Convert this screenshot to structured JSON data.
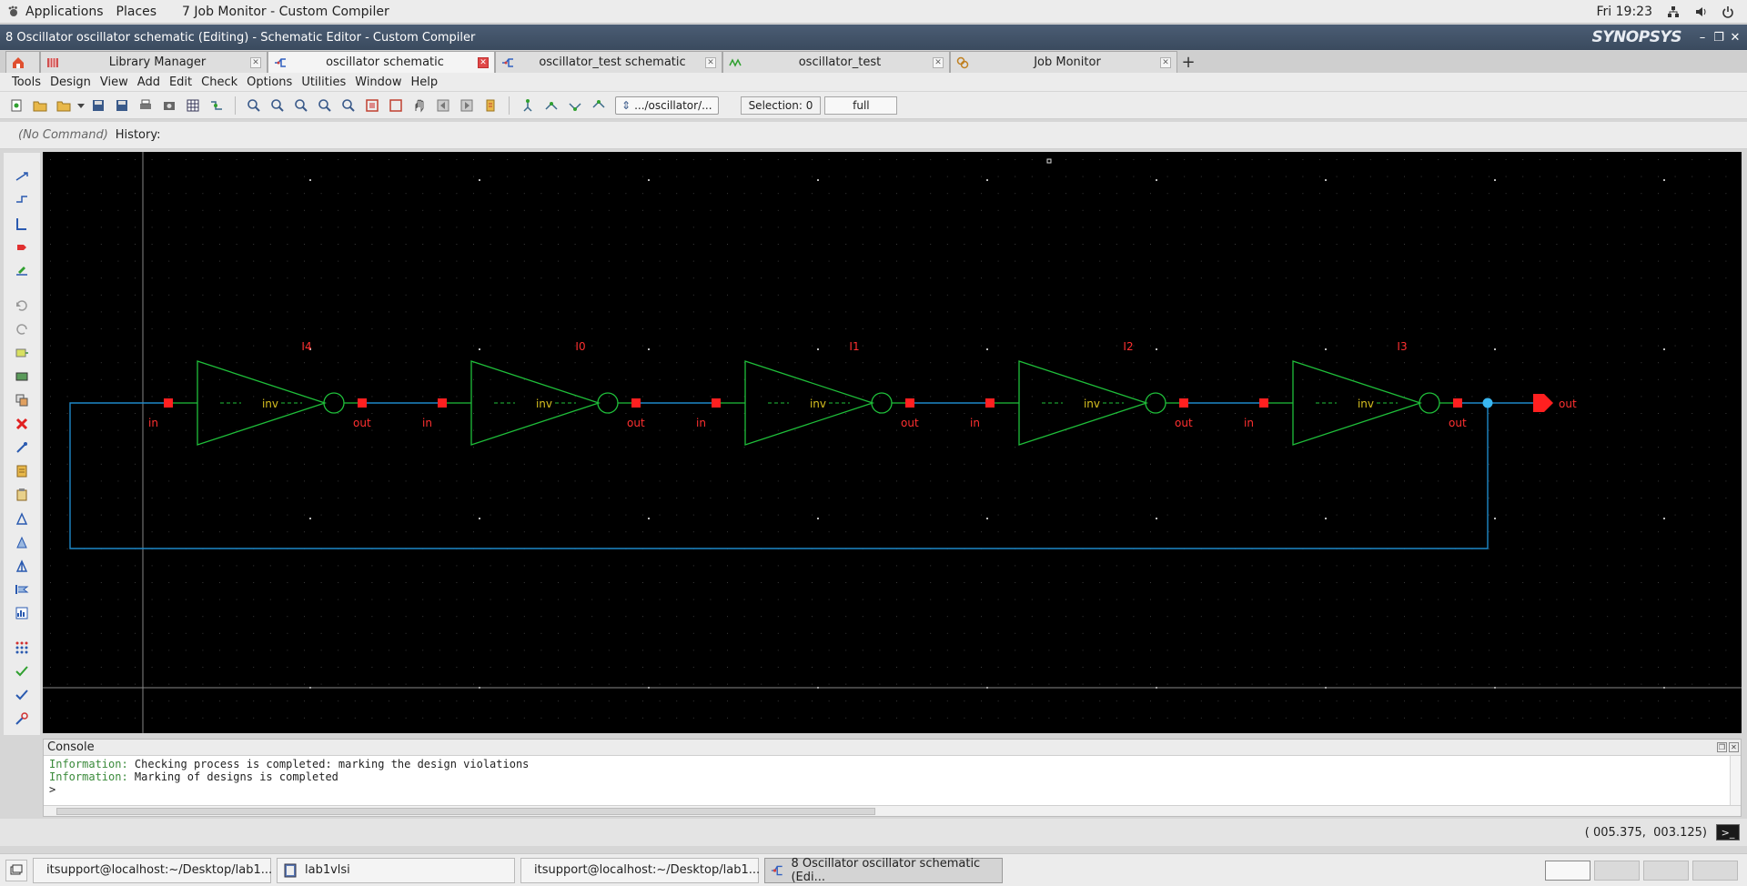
{
  "system_bar": {
    "applications": "Applications",
    "places": "Places",
    "window_title": "7 Job Monitor - Custom Compiler",
    "clock": "Fri 19:23"
  },
  "window": {
    "title": "8 Oscillator oscillator schematic (Editing) - Schematic Editor - Custom Compiler",
    "brand": "SYNOPSYS"
  },
  "tabs": [
    {
      "label": "Library Manager",
      "active": false
    },
    {
      "label": "oscillator schematic",
      "active": true
    },
    {
      "label": "oscillator_test schematic",
      "active": false
    },
    {
      "label": "oscillator_test",
      "active": false
    },
    {
      "label": "Job Monitor",
      "active": false
    }
  ],
  "menu": [
    "Tools",
    "Design",
    "View",
    "Add",
    "Edit",
    "Check",
    "Options",
    "Utilities",
    "Window",
    "Help"
  ],
  "toolbar": {
    "path": ".../oscillator/...",
    "selection": "Selection: 0",
    "mode": "full"
  },
  "command": {
    "current": "(No Command)",
    "history_label": "History:"
  },
  "schematic": {
    "instances": [
      {
        "name": "I4",
        "cell": "inv",
        "in": "in",
        "out": "out"
      },
      {
        "name": "I0",
        "cell": "inv",
        "in": "in",
        "out": "out"
      },
      {
        "name": "I1",
        "cell": "inv",
        "in": "in",
        "out": "out"
      },
      {
        "name": "I2",
        "cell": "inv",
        "in": "in",
        "out": "out"
      },
      {
        "name": "I3",
        "cell": "inv",
        "in": "in",
        "out": "out"
      }
    ],
    "output_pin": "out",
    "colors": {
      "background": "#000000",
      "gate": "#1fbf3a",
      "wire": "#1e88c8",
      "pin": "#ff2020",
      "label": "#ff3030",
      "cellname": "#d8c020",
      "grid": "#3a3a3a"
    }
  },
  "console": {
    "title": "Console",
    "lines": [
      {
        "tag": "Information:",
        "text": " Checking process is completed: marking the design violations"
      },
      {
        "tag": "Information:",
        "text": " Marking of designs is completed"
      }
    ],
    "prompt": ">"
  },
  "status": {
    "coordinates": "( 005.375,  003.125)"
  },
  "taskbar": [
    {
      "label": "itsupport@localhost:~/Desktop/lab1...",
      "icon": "terminal-icon",
      "active": false
    },
    {
      "label": "lab1vlsi",
      "icon": "folder-icon",
      "active": false
    },
    {
      "label": "itsupport@localhost:~/Desktop/lab1...",
      "icon": "terminal-icon",
      "active": false
    },
    {
      "label": "8 Oscillator oscillator schematic (Edi...",
      "icon": "schematic-icon",
      "active": true
    }
  ]
}
